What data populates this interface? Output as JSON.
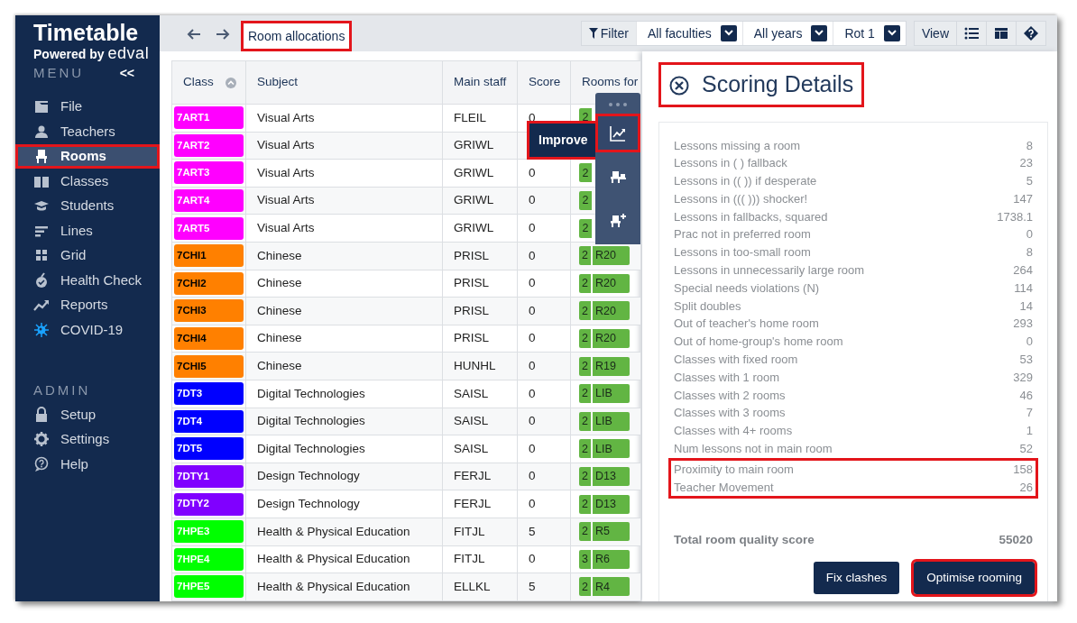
{
  "sidebar": {
    "title": "Timetable",
    "powered_by": "Powered by",
    "brand": "edval",
    "menu_label": "MENU",
    "collapse": "<<",
    "items": [
      {
        "label": "File",
        "selected": false,
        "highlighted": false
      },
      {
        "label": "Teachers",
        "selected": false,
        "highlighted": false
      },
      {
        "label": "Rooms",
        "selected": true,
        "highlighted": true
      },
      {
        "label": "Classes",
        "selected": false,
        "highlighted": false
      },
      {
        "label": "Students",
        "selected": false,
        "highlighted": false
      },
      {
        "label": "Lines",
        "selected": false,
        "highlighted": false
      },
      {
        "label": "Grid",
        "selected": false,
        "highlighted": false
      },
      {
        "label": "Health Check",
        "selected": false,
        "highlighted": false
      },
      {
        "label": "Reports",
        "selected": false,
        "highlighted": false
      },
      {
        "label": "COVID-19",
        "selected": false,
        "highlighted": false
      }
    ],
    "admin_label": "ADMIN",
    "admin_items": [
      {
        "label": "Setup",
        "selected": false
      },
      {
        "label": "Settings",
        "selected": false
      },
      {
        "label": "Help",
        "selected": false
      }
    ]
  },
  "topbar": {
    "tab": {
      "label": "Room allocations",
      "highlighted": true
    },
    "filter": "Filter",
    "dropdowns": [
      {
        "label": "All faculties"
      },
      {
        "label": "All years"
      },
      {
        "label": "Rot 1"
      }
    ],
    "view": "View"
  },
  "table": {
    "columns": [
      "Class",
      "Subject",
      "Main staff",
      "Score",
      "Rooms for"
    ],
    "rows": [
      {
        "class": "7ART1",
        "color": "#ff00ff",
        "subject": "Visual Arts",
        "staff": "FLEIL",
        "score": "0",
        "count": "2"
      },
      {
        "class": "7ART2",
        "color": "#ff00ff",
        "subject": "Visual Arts",
        "staff": "GRIWL"
      },
      {
        "class": "7ART3",
        "color": "#ff00ff",
        "subject": "Visual Arts",
        "staff": "GRIWL",
        "score": "0",
        "count": "2"
      },
      {
        "class": "7ART4",
        "color": "#ff00ff",
        "subject": "Visual Arts",
        "staff": "GRIWL",
        "score": "0",
        "count": "2"
      },
      {
        "class": "7ART5",
        "color": "#ff00ff",
        "subject": "Visual Arts",
        "staff": "GRIWL",
        "score": "0",
        "count": "2"
      },
      {
        "class": "7CHI1",
        "color": "#ff8000",
        "subject": "Chinese",
        "staff": "PRISL",
        "score": "0",
        "count": "2",
        "room": "R20"
      },
      {
        "class": "7CHI2",
        "color": "#ff8000",
        "subject": "Chinese",
        "staff": "PRISL",
        "score": "0",
        "count": "2",
        "room": "R20"
      },
      {
        "class": "7CHI3",
        "color": "#ff8000",
        "subject": "Chinese",
        "staff": "PRISL",
        "score": "0",
        "count": "2",
        "room": "R20"
      },
      {
        "class": "7CHI4",
        "color": "#ff8000",
        "subject": "Chinese",
        "staff": "PRISL",
        "score": "0",
        "count": "2",
        "room": "R20"
      },
      {
        "class": "7CHI5",
        "color": "#ff8000",
        "subject": "Chinese",
        "staff": "HUNHL",
        "score": "0",
        "count": "2",
        "room": "R19"
      },
      {
        "class": "7DT3",
        "color": "#0000ff",
        "subject": "Digital Technologies",
        "staff": "SAISL",
        "score": "0",
        "count": "2",
        "room": "LIB"
      },
      {
        "class": "7DT4",
        "color": "#0000ff",
        "subject": "Digital Technologies",
        "staff": "SAISL",
        "score": "0",
        "count": "2",
        "room": "LIB"
      },
      {
        "class": "7DT5",
        "color": "#0000ff",
        "subject": "Digital Technologies",
        "staff": "SAISL",
        "score": "0",
        "count": "2",
        "room": "LIB"
      },
      {
        "class": "7DTY1",
        "color": "#8000ff",
        "subject": "Design Technology",
        "staff": "FERJL",
        "score": "0",
        "count": "2",
        "room": "D13"
      },
      {
        "class": "7DTY2",
        "color": "#8000ff",
        "subject": "Design Technology",
        "staff": "FERJL",
        "score": "0",
        "count": "2",
        "room": "D13"
      },
      {
        "class": "7HPE3",
        "color": "#00ff00",
        "subject": "Health & Physical Education",
        "staff": "FITJL",
        "score": "5",
        "count": "2",
        "room": "R5"
      },
      {
        "class": "7HPE4",
        "color": "#00ff00",
        "subject": "Health & Physical Education",
        "staff": "FITJL",
        "score": "0",
        "count": "3",
        "room": "R6"
      },
      {
        "class": "7HPE5",
        "color": "#00ff00",
        "subject": "Health & Physical Education",
        "staff": "ELLKL",
        "score": "5",
        "count": "2",
        "room": "R4"
      }
    ]
  },
  "float_toolbar": {
    "tools": [
      {
        "kind": "improve",
        "tooltip": "Improve",
        "highlighted": true
      },
      {
        "kind": "room"
      },
      {
        "kind": "room-add"
      }
    ]
  },
  "panel": {
    "title": "Scoring Details",
    "highlighted": true,
    "metric_groups": [
      {
        "metrics": [
          {
            "label": "Lessons missing a room",
            "value": "8"
          },
          {
            "label": "Lessons in ( ) fallback",
            "value": "23"
          },
          {
            "label": "Lessons in (( )) if desperate",
            "value": "5"
          },
          {
            "label": "Lessons in ((( ))) shocker!",
            "value": "147"
          },
          {
            "label": "Lessons in fallbacks, squared",
            "value": "1738.1"
          },
          {
            "label": "Prac not in preferred room",
            "value": "0"
          },
          {
            "label": "Lessons in too-small room",
            "value": "8"
          },
          {
            "label": "Lessons in unnecessarily large room",
            "value": "264"
          },
          {
            "label": "Special needs violations (N)",
            "value": "114"
          },
          {
            "label": "Split doubles",
            "value": "14"
          },
          {
            "label": "Out of teacher's home room",
            "value": "293"
          },
          {
            "label": "Out of home-group's home room",
            "value": "0"
          },
          {
            "label": "Classes with fixed room",
            "value": "53"
          },
          {
            "label": "Classes with 1 room",
            "value": "329"
          },
          {
            "label": "Classes with 2 rooms",
            "value": "46"
          },
          {
            "label": "Classes with 3 rooms",
            "value": "7"
          },
          {
            "label": "Classes with 4+ rooms",
            "value": "1"
          },
          {
            "label": "Num lessons not in main room",
            "value": "52"
          }
        ]
      },
      {
        "highlighted": true,
        "metrics": [
          {
            "label": "Proximity to main room",
            "value": "158"
          },
          {
            "label": "Teacher Movement",
            "value": "26"
          }
        ]
      }
    ],
    "total": {
      "label": "Total room quality score",
      "value": "55020"
    },
    "buttons": [
      {
        "label": "Fix clashes",
        "highlighted": false
      },
      {
        "label": "Optimise rooming",
        "highlighted": true
      }
    ]
  }
}
